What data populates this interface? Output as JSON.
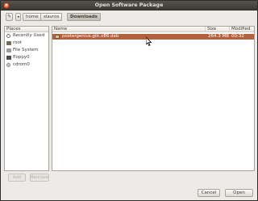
{
  "window": {
    "title": "Open Software Package"
  },
  "pathbar": {
    "crumbs": [
      "home",
      "slavros",
      "Downloads"
    ],
    "active_index": 2
  },
  "places": {
    "header": "Places",
    "items": [
      {
        "label": "Recently Used",
        "icon": "recent-icon"
      },
      {
        "label": "root",
        "icon": "home-folder-icon"
      },
      {
        "label": "File System",
        "icon": "filesystem-icon"
      },
      {
        "label": "floppy0",
        "icon": "floppy-icon"
      },
      {
        "label": "cdrom0",
        "icon": "cdrom-icon"
      }
    ],
    "add_label": "Add",
    "remove_label": "Remove"
  },
  "files": {
    "columns": {
      "name": "Name",
      "size": "Size",
      "modified": "Modified"
    },
    "rows": [
      {
        "name": "postergenius.gtk.x86.deb",
        "size": "264.3 MB",
        "modified": "00:32",
        "selected": true
      }
    ]
  },
  "buttons": {
    "cancel": "Cancel",
    "open": "Open"
  },
  "colors": {
    "selection": "#b5603d",
    "titlebar": "#3d3b36",
    "window_bg": "#edebe7"
  }
}
